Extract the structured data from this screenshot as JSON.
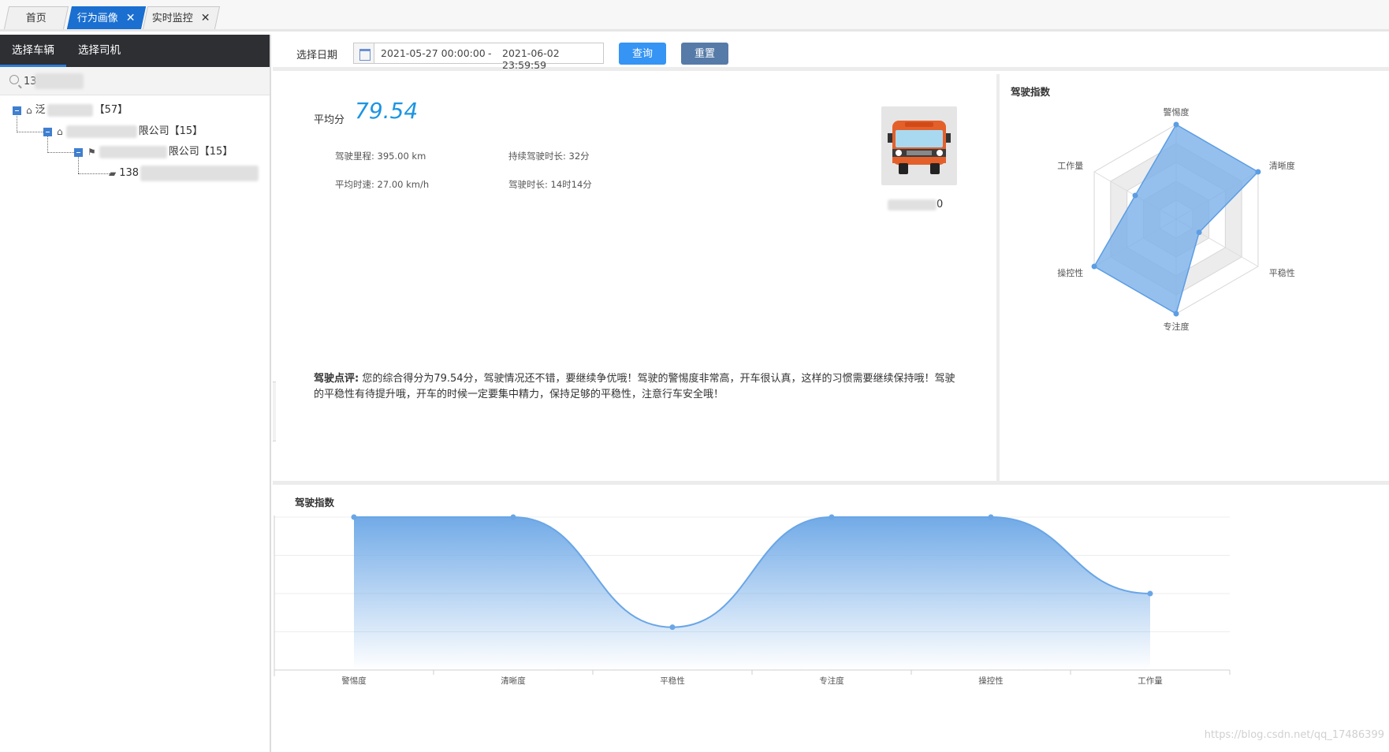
{
  "tabs": [
    {
      "label": "首页",
      "active": false,
      "closable": false
    },
    {
      "label": "行为画像",
      "active": true,
      "closable": true
    },
    {
      "label": "实时监控",
      "active": false,
      "closable": true
    }
  ],
  "close_glyph": "✕",
  "left_panel": {
    "tabs": [
      "选择车辆",
      "选择司机"
    ],
    "search_value": "13",
    "tree": [
      {
        "label_visible": "泛",
        "suffix": "【57】",
        "icon": "home-icon"
      },
      {
        "label_visible": "限公司",
        "suffix": "【15】",
        "icon": "home-icon"
      },
      {
        "label_visible": "限公司",
        "suffix": "【15】",
        "icon": "flag-icon"
      },
      {
        "label_visible": "138",
        "suffix": "",
        "icon": "truck-icon"
      }
    ]
  },
  "filter": {
    "label": "选择日期",
    "start": "2021-05-27 00:00:00",
    "separator": "-",
    "end": "2021-06-02 23:59:59",
    "query_label": "查询",
    "reset_label": "重置"
  },
  "score": {
    "label": "平均分",
    "value": "79.54",
    "mileage": "驾驶里程: 395.00 km",
    "continuous_duration": "持续驾驶时长: 32分",
    "avg_speed": "平均时速: 27.00 km/h",
    "drive_duration": "驾驶时长: 14时14分",
    "plate_suffix": "0",
    "comment_label": "驾驶点评:",
    "comment_text": "您的综合得分为79.54分，驾驶情况还不错，要继续争优哦！驾驶的警惕度非常高，开车很认真，这样的习惯需要继续保持哦！驾驶的平稳性有待提升哦，开车的时候一定要集中精力，保持足够的平稳性，注意行车安全哦！"
  },
  "chart_data": [
    {
      "type": "radar",
      "title": "驾驶指数",
      "indicators": [
        "警惕度",
        "清晰度",
        "平稳性",
        "专注度",
        "操控性",
        "工作量"
      ],
      "max": 100,
      "values": [
        100,
        100,
        28,
        100,
        100,
        50
      ],
      "color": "#7ab0ea"
    },
    {
      "type": "area",
      "title": "驾驶指数",
      "categories": [
        "警惕度",
        "清晰度",
        "平稳性",
        "专注度",
        "操控性",
        "工作量"
      ],
      "values": [
        100,
        100,
        28,
        100,
        100,
        50
      ],
      "ylim": [
        0,
        100
      ],
      "yticks": [
        0,
        25,
        50,
        75,
        100
      ],
      "smooth": true,
      "grid": true,
      "color": "#6aa6e6"
    }
  ],
  "watermark": "https://blog.csdn.net/qq_17486399"
}
